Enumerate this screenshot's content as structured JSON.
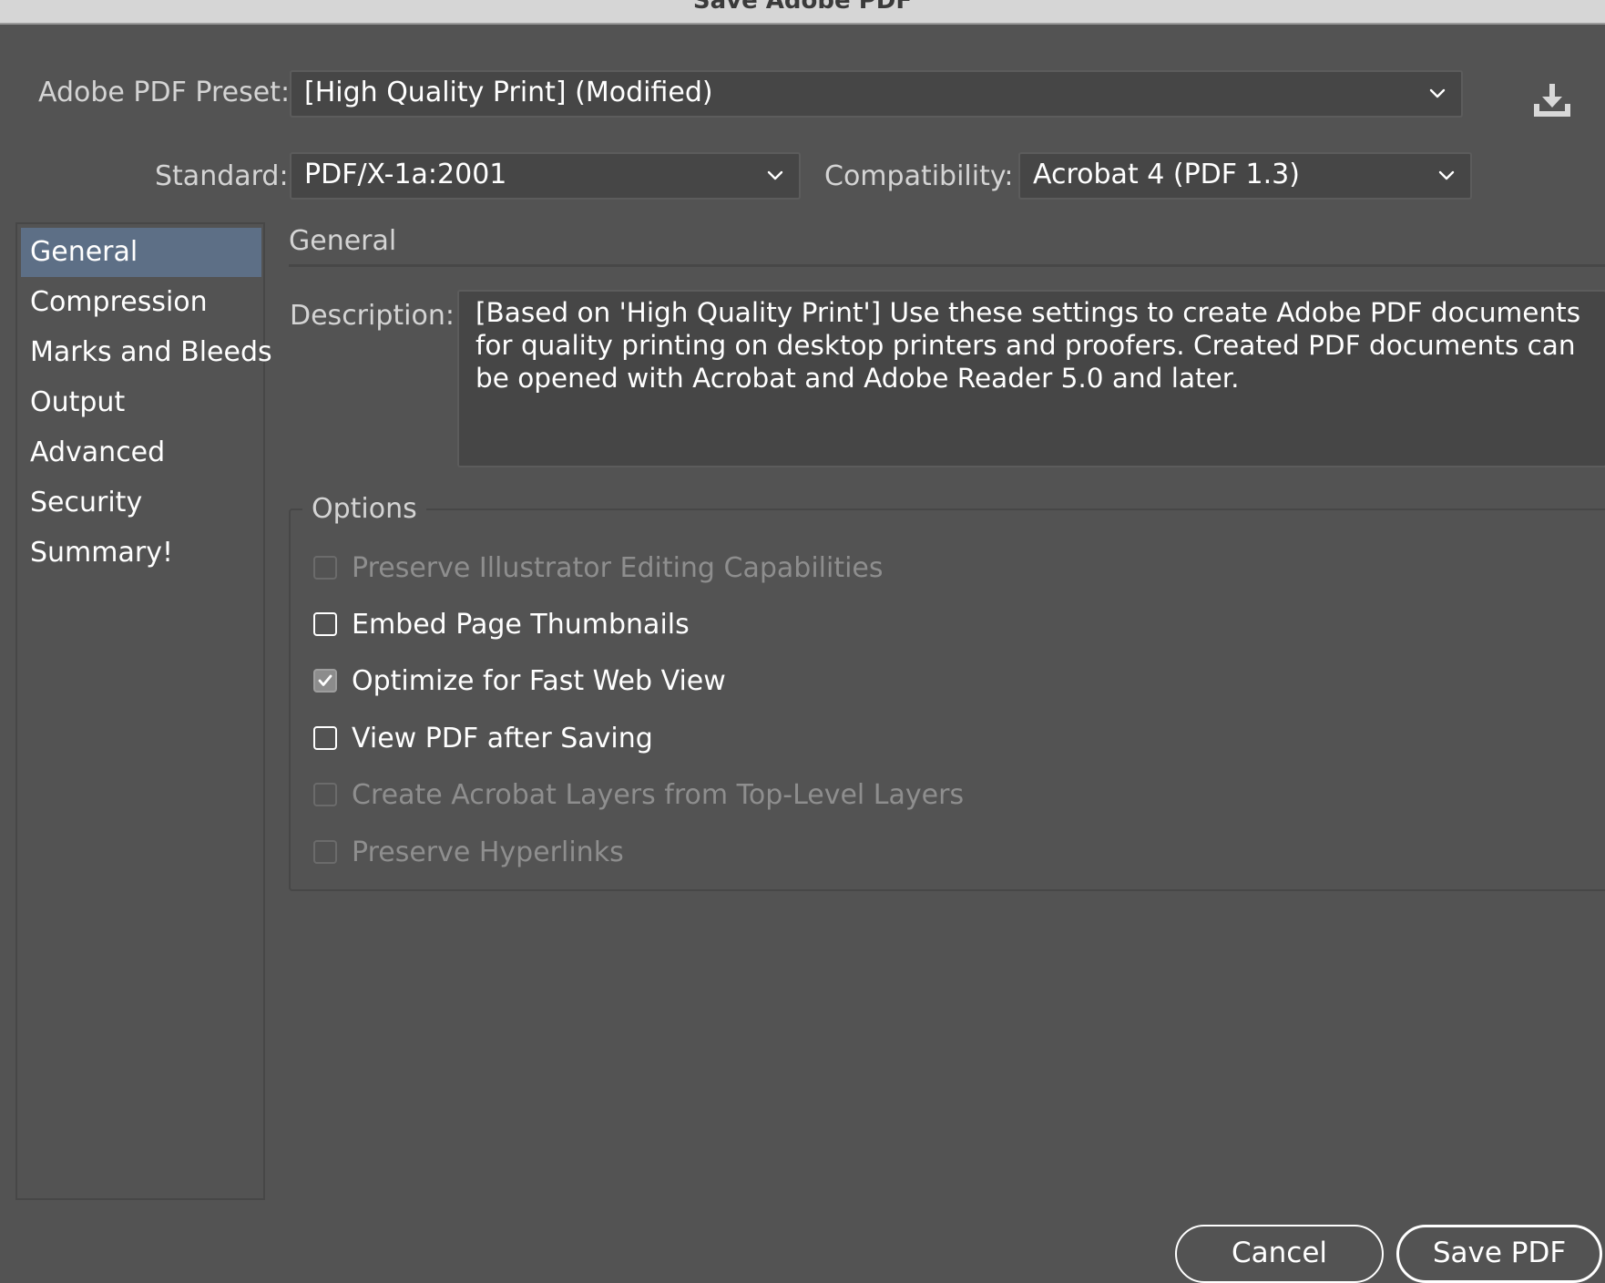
{
  "window": {
    "title": "Save Adobe PDF"
  },
  "preset": {
    "label": "Adobe PDF Preset:",
    "value": "[High Quality Print] (Modified)"
  },
  "standard": {
    "label": "Standard:",
    "value": "PDF/X-1a:2001"
  },
  "compatibility": {
    "label": "Compatibility:",
    "value": "Acrobat 4 (PDF 1.3)"
  },
  "sidebar": {
    "items": [
      {
        "label": "General",
        "selected": true
      },
      {
        "label": "Compression",
        "selected": false
      },
      {
        "label": "Marks and Bleeds",
        "selected": false
      },
      {
        "label": "Output",
        "selected": false
      },
      {
        "label": "Advanced",
        "selected": false
      },
      {
        "label": "Security",
        "selected": false
      },
      {
        "label": "Summary!",
        "selected": false
      }
    ]
  },
  "general": {
    "title": "General",
    "description_label": "Description:",
    "description": "[Based on 'High Quality Print'] Use these settings to create Adobe PDF documents for quality printing on desktop printers and proofers.  Created PDF documents can be opened with Acrobat and Adobe Reader 5.0 and later."
  },
  "options": {
    "title": "Options",
    "items": [
      {
        "label": "Preserve Illustrator Editing Capabilities",
        "checked": false,
        "enabled": false
      },
      {
        "label": "Embed Page Thumbnails",
        "checked": false,
        "enabled": true
      },
      {
        "label": "Optimize for Fast Web View",
        "checked": true,
        "enabled": true
      },
      {
        "label": "View PDF after Saving",
        "checked": false,
        "enabled": true
      },
      {
        "label": "Create Acrobat Layers from Top-Level Layers",
        "checked": false,
        "enabled": false
      },
      {
        "label": "Preserve Hyperlinks",
        "checked": false,
        "enabled": false
      }
    ]
  },
  "buttons": {
    "cancel": "Cancel",
    "save": "Save PDF"
  },
  "icons": {
    "save_preset": "download-icon",
    "dropdown": "chevron-down-icon",
    "check": "checkmark-icon"
  },
  "colors": {
    "background": "#535353",
    "field": "#464646",
    "selection": "#5d6f86",
    "text": "#ffffff",
    "label": "#d4d4d4",
    "disabled": "#8e8e8e"
  }
}
